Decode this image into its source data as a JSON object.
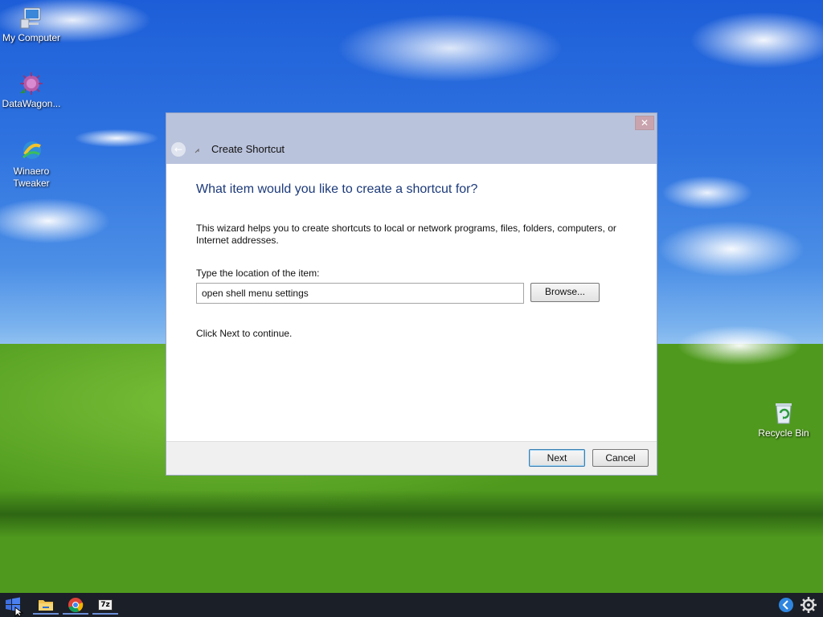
{
  "desktop": {
    "icons": [
      {
        "label": "My Computer",
        "icon": "computer-icon"
      },
      {
        "label": "DataWagon...",
        "icon": "datawagon-icon"
      },
      {
        "label": "Winaero Tweaker",
        "icon": "winaero-tweaker-icon"
      },
      {
        "label": "Recycle Bin",
        "icon": "recycle-bin-icon"
      }
    ]
  },
  "dialog": {
    "title": "Create Shortcut",
    "close_glyph": "✕",
    "back_glyph": "←",
    "heading": "What item would you like to create a shortcut for?",
    "description": "This wizard helps you to create shortcuts to local or network programs, files, folders, computers, or Internet addresses.",
    "location_label": "Type the location of the item:",
    "location_value": "open shell menu settings",
    "browse_label": "Browse...",
    "continue_text": "Click Next to continue.",
    "next_label": "Next",
    "cancel_label": "Cancel"
  },
  "taskbar": {
    "items": [
      "start-button",
      "file-explorer-icon",
      "chrome-icon",
      "7zip-icon"
    ],
    "tray": [
      "back-arrow-icon",
      "gear-icon"
    ],
    "sevenzip_text": "7z"
  },
  "colors": {
    "heading": "#1c3a7a",
    "titlebar": "#bac3dc",
    "taskbar": "#1b1f27"
  }
}
